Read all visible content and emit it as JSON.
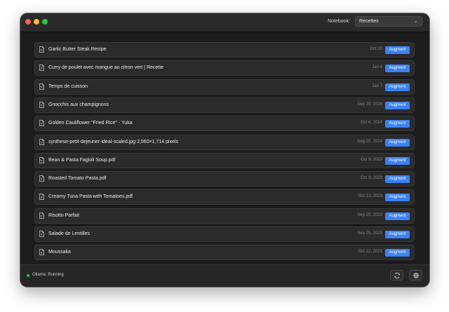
{
  "toolbar": {
    "notebook_label": "Notebook:",
    "notebook_value": "Recettes"
  },
  "notes": [
    {
      "title": "Garlic Butter Steak Recipe",
      "date": "Oct 20",
      "action": "Augment"
    },
    {
      "title": "Curry de poulet avec mangue au citron vert | Recette",
      "date": "Jan 4",
      "action": "Augment"
    },
    {
      "title": "Temps de cuisson",
      "date": "Jan 7",
      "action": "Augment"
    },
    {
      "title": "Gnocchis aux champignons",
      "date": "Sep 25, 2024",
      "action": "Augment"
    },
    {
      "title": "Golden Cauliflower \"Fried Rice\" - Yuka",
      "date": "Oct 6, 2024",
      "action": "Augment"
    },
    {
      "title": "synthese-petit-dejeuner-ideal-scaled.jpg 2,560×1,714 pixels",
      "date": "Aug 20, 2024",
      "action": "Augment"
    },
    {
      "title": "Bean & Pasta Fagioli Soup.pdf",
      "date": "Oct 9, 2023",
      "action": "Augment"
    },
    {
      "title": "Roasted Tomato Pasta.pdf",
      "date": "Oct 9, 2023",
      "action": "Augment"
    },
    {
      "title": "Creamy Tuna Pasta with Tomatoes.pdf",
      "date": "Oct 13, 2023",
      "action": "Augment"
    },
    {
      "title": "Risotto Parfait",
      "date": "Sep 25, 2023",
      "action": "Augment"
    },
    {
      "title": "Salade de Lentilles",
      "date": "Sep 25, 2023",
      "action": "Augment"
    },
    {
      "title": "Moussaka",
      "date": "Oct 22, 2023",
      "action": "Augment"
    }
  ],
  "status": {
    "text": "Ollama: Running",
    "color": "#22c55e"
  },
  "icons": {
    "note": "document-icon",
    "refresh": "refresh-icon",
    "settings": "gear-icon"
  },
  "colors": {
    "accent": "#3b82f6",
    "background": "#1c1c1c"
  }
}
